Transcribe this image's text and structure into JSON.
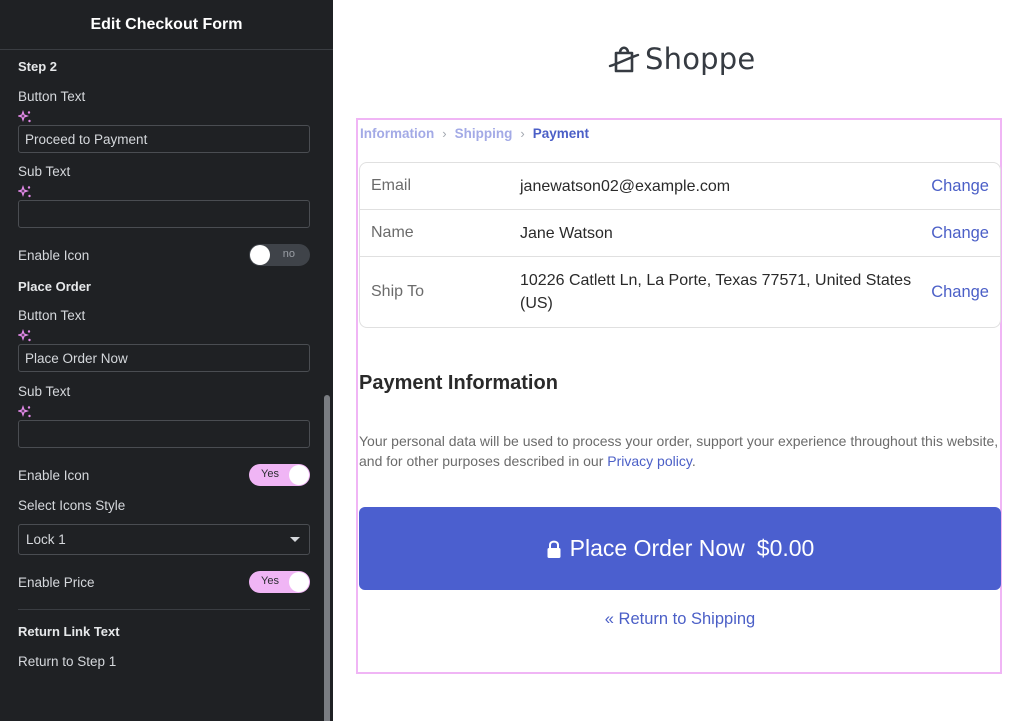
{
  "sidebar": {
    "title": "Edit Checkout Form",
    "step2": {
      "section_title": "Step 2",
      "button_text_label": "Button Text",
      "button_text_value": "Proceed to Payment",
      "sub_text_label": "Sub Text",
      "sub_text_value": "",
      "enable_icon_label": "Enable Icon",
      "enable_icon_toggle": "no"
    },
    "place_order": {
      "section_title": "Place Order",
      "button_text_label": "Button Text",
      "button_text_value": "Place Order Now",
      "sub_text_label": "Sub Text",
      "sub_text_value": "",
      "enable_icon_label": "Enable Icon",
      "enable_icon_toggle": "Yes",
      "icon_style_label": "Select Icons Style",
      "icon_style_value": "Lock 1",
      "enable_price_label": "Enable Price",
      "enable_price_toggle": "Yes"
    },
    "return_link": {
      "section_title": "Return Link Text",
      "value": "Return to Step 1"
    }
  },
  "preview": {
    "logo_text": "Shoppe",
    "breadcrumb": {
      "items": [
        "Information",
        "Shipping",
        "Payment"
      ]
    },
    "review": [
      {
        "label": "Email",
        "value": "janewatson02@example.com",
        "action": "Change"
      },
      {
        "label": "Name",
        "value": "Jane Watson",
        "action": "Change"
      },
      {
        "label": "Ship To",
        "value": "10226 Catlett Ln, La Porte, Texas 77571, United States (US)",
        "action": "Change"
      }
    ],
    "payment_title": "Payment Information",
    "privacy_text": "Your personal data will be used to process your order, support your experience throughout this website, and for other purposes described in our ",
    "privacy_link": "Privacy policy",
    "privacy_end": ".",
    "place_order_label": "Place Order Now",
    "place_order_price": "$0.00",
    "return_link": "« Return to Shipping"
  },
  "colors": {
    "accent": "#4b5fcf",
    "toggle_on": "#f0b5f5",
    "frame_outline": "#f0b5f5",
    "sidebar_bg": "#1f2124"
  }
}
